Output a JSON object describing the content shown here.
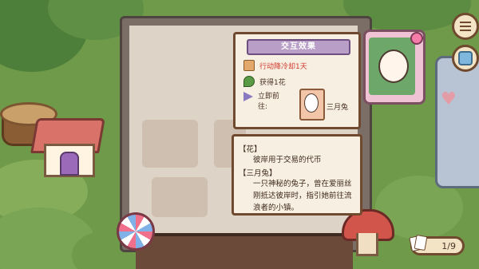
{
  "effect_panel": {
    "title": "交互效果",
    "rows": [
      {
        "icon": "scroll-icon",
        "text": "行动降冷却1天"
      },
      {
        "icon": "leaf-icon",
        "text": "获得1花"
      },
      {
        "icon": "paper-plane-icon",
        "text": "立即前往:"
      }
    ],
    "target_name": "三月兔"
  },
  "info_panel": {
    "term1_title": "【花】",
    "term1_desc": "彼岸用于交易的代币",
    "term2_title": "【三月兔】",
    "term2_desc": "一只神秘的兔子，曾在爱丽丝刚抵达彼岸时，指引她前往流浪者的小镇。"
  },
  "hud": {
    "menu_icon": "hamburger-menu-icon",
    "bag_icon": "bag-icon",
    "deck_counter": "1/9"
  },
  "colors": {
    "panel_bg": "#f7efe2",
    "panel_border": "#6f4a2e",
    "banner": "#b99fc7",
    "highlight_red": "#d13a2e"
  }
}
